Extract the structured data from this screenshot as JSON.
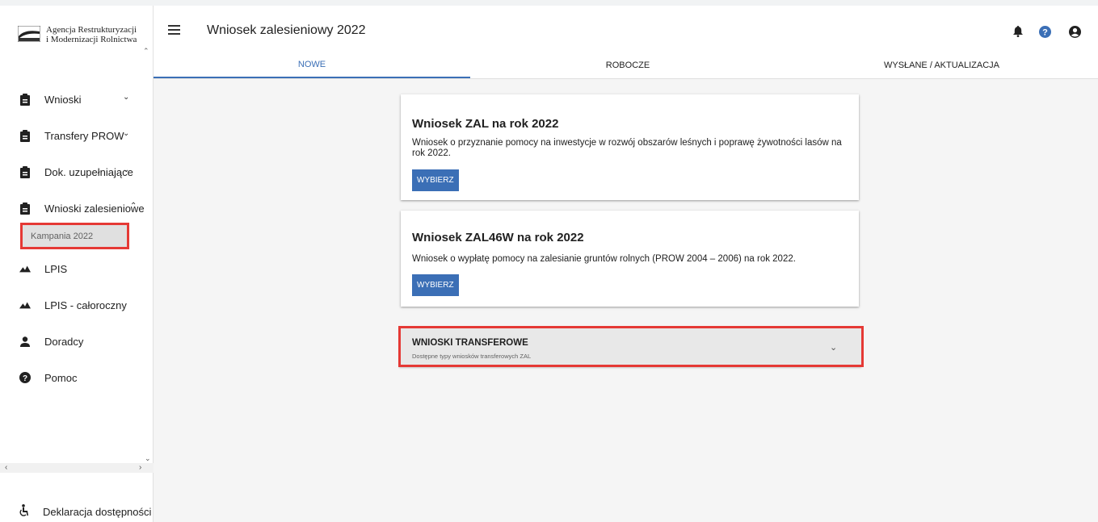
{
  "sidebar": {
    "logo_line1": "Agencja Restrukturyzacji",
    "logo_line2": "i Modernizacji Rolnictwa",
    "items": [
      {
        "label": "Wnioski",
        "icon": "clipboard-icon",
        "chevron": "⌄"
      },
      {
        "label": "Transfery PROW",
        "icon": "clipboard-icon",
        "chevron": "⌄"
      },
      {
        "label": "Dok. uzupełniające",
        "icon": "clipboard-icon",
        "chevron": "⌄"
      },
      {
        "label": "Wnioski zalesieniowe",
        "icon": "clipboard-icon",
        "chevron": "⌃"
      },
      {
        "label": "LPIS",
        "icon": "terrain-icon"
      },
      {
        "label": "LPIS - całoroczny",
        "icon": "terrain-icon"
      },
      {
        "label": "Doradcy",
        "icon": "person-icon"
      },
      {
        "label": "Pomoc",
        "icon": "help-icon"
      }
    ],
    "sub_item": "Kampania 2022",
    "footer_label": "Deklaracja dostępności"
  },
  "header": {
    "title": "Wniosek zalesieniowy 2022"
  },
  "tabs": [
    {
      "label": "NOWE",
      "active": true
    },
    {
      "label": "ROBOCZE",
      "active": false
    },
    {
      "label": "WYSŁANE / AKTUALIZACJA",
      "active": false
    }
  ],
  "cards": [
    {
      "title": "Wniosek ZAL na rok 2022",
      "description": "Wniosek o przyznanie pomocy na inwestycje w rozwój obszarów leśnych i poprawę żywotności lasów na rok 2022.",
      "button": "WYBIERZ"
    },
    {
      "title": "Wniosek ZAL46W na rok 2022",
      "description": "Wniosek o wypłatę pomocy na zalesianie gruntów rolnych (PROW 2004 – 2006) na rok 2022.",
      "button": "WYBIERZ"
    }
  ],
  "transfer_panel": {
    "title": "WNIOSKI TRANSFEROWE",
    "subtitle": "Dostępne typy wniosków transferowych ZAL"
  },
  "colors": {
    "accent": "#3b6fb6",
    "highlight": "#e53935",
    "background": "#f5f5f5"
  }
}
